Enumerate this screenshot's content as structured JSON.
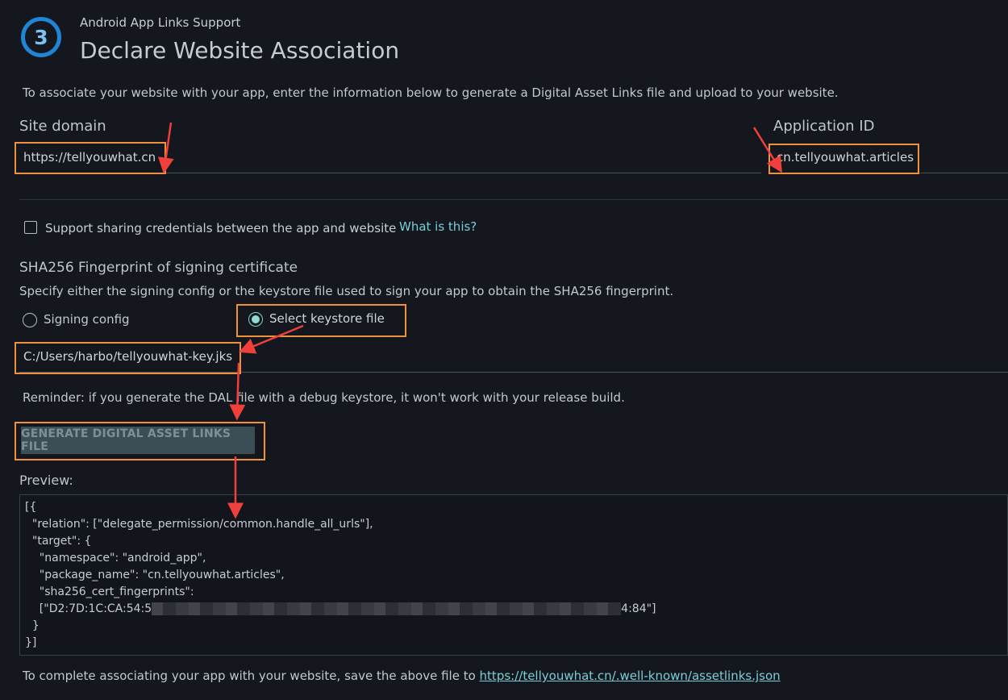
{
  "header": {
    "step_number": "3",
    "supertitle": "Android App Links Support",
    "title": "Declare Website Association"
  },
  "intro_text": "To associate your website with your app, enter the information below to generate a Digital Asset Links file and upload to your website.",
  "site_domain": {
    "label": "Site domain",
    "value": "https://tellyouwhat.cn"
  },
  "application_id": {
    "label": "Application ID",
    "value": "cn.tellyouwhat.articles"
  },
  "credentials": {
    "checkbox_label": "Support sharing credentials between the app and website",
    "checked": false,
    "help_link": "What is this?"
  },
  "sha256": {
    "heading": "SHA256 Fingerprint of signing certificate",
    "description": "Specify either the signing config or the keystore file used to sign your app to obtain the SHA256 fingerprint.",
    "options": [
      "Signing config",
      "Select keystore file"
    ],
    "selected_option": "Select keystore file",
    "keystore_path": "C:/Users/harbo/tellyouwhat-key.jks"
  },
  "reminder": "Reminder: if you generate the DAL file with a debug keystore, it won't work with your release build.",
  "generate_button": "GENERATE DIGITAL ASSET LINKS FILE",
  "preview": {
    "label": "Preview:",
    "lines": [
      "[{",
      "  \"relation\": [\"delegate_permission/common.handle_all_urls\"],",
      "  \"target\": {",
      "    \"namespace\": \"android_app\",",
      "    \"package_name\": \"cn.tellyouwhat.articles\",",
      "    \"sha256_cert_fingerprints\":",
      "    [\"D2:7D:1C:CA:54:5",
      "  }",
      "}]"
    ],
    "fingerprint_tail": "4:84\"]"
  },
  "footer": {
    "text": "To complete associating your app with your website, save the above file to ",
    "link": "https://tellyouwhat.cn/.well-known/assetlinks.json"
  },
  "colors": {
    "background": "#14171e",
    "accent_blue": "#1f86d6",
    "link_teal": "#79cfd8",
    "annotation_orange": "#f0913b",
    "annotation_red": "#f0403c"
  }
}
